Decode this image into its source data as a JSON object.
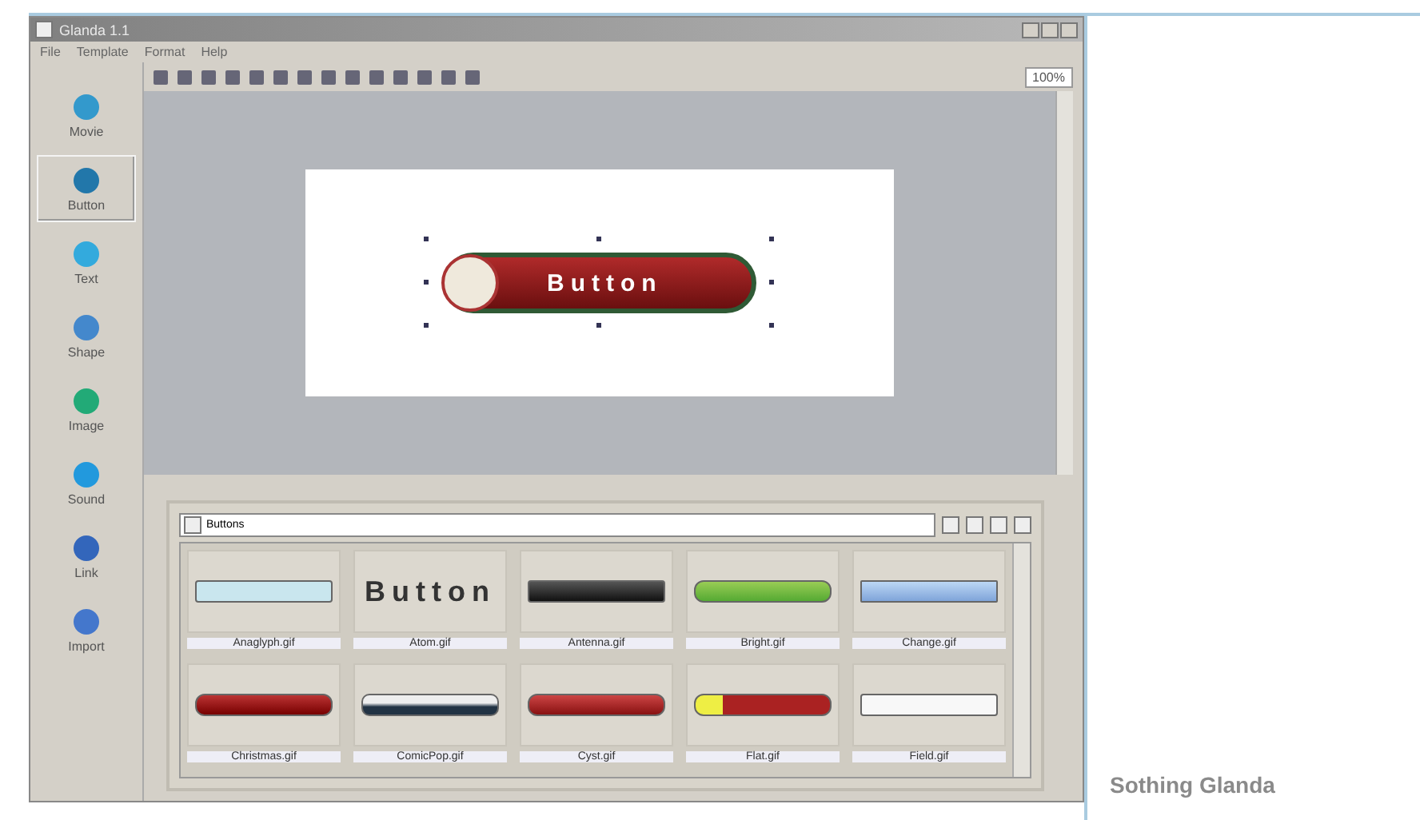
{
  "window": {
    "title": "Glanda 1.1"
  },
  "menu": [
    "File",
    "Template",
    "Format",
    "Help"
  ],
  "tools": [
    {
      "label": "Movie",
      "selected": false
    },
    {
      "label": "Button",
      "selected": true
    },
    {
      "label": "Text",
      "selected": false
    },
    {
      "label": "Shape",
      "selected": false
    },
    {
      "label": "Image",
      "selected": false
    },
    {
      "label": "Sound",
      "selected": false
    },
    {
      "label": "Link",
      "selected": false
    },
    {
      "label": "Import",
      "selected": false
    }
  ],
  "zoom": "100%",
  "stage": {
    "button_label": "Button"
  },
  "library": {
    "folder": "Buttons",
    "items": [
      {
        "kind": "aqua",
        "caption": "Anaglyph.gif"
      },
      {
        "kind": "text",
        "text": "Button",
        "caption": "Atom.gif"
      },
      {
        "kind": "dark",
        "caption": "Antenna.gif"
      },
      {
        "kind": "green",
        "caption": "Bright.gif"
      },
      {
        "kind": "blue",
        "caption": "Change.gif"
      },
      {
        "kind": "santa",
        "caption": "Christmas.gif"
      },
      {
        "kind": "stripe",
        "caption": "ComicPop.gif"
      },
      {
        "kind": "red",
        "caption": "Cyst.gif"
      },
      {
        "kind": "yellow",
        "caption": "Flat.gif"
      },
      {
        "kind": "white",
        "caption": "Field.gif"
      }
    ]
  },
  "caption": "Sothing Glanda"
}
